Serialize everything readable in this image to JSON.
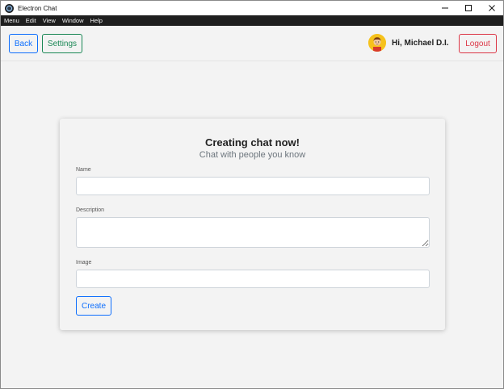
{
  "window": {
    "title": "Electron Chat",
    "icon": "electron-app-icon",
    "controls": [
      "minimize-icon",
      "maximize-icon",
      "close-icon"
    ]
  },
  "menubar": {
    "items": [
      "Menu",
      "Edit",
      "View",
      "Window",
      "Help"
    ]
  },
  "header": {
    "back_label": "Back",
    "settings_label": "Settings",
    "greeting": "Hi, Michael D.I.",
    "logout_label": "Logout",
    "avatar_icon": "cartoon-avatar-icon"
  },
  "form": {
    "title": "Creating chat now!",
    "subtitle": "Chat with people you know",
    "name_label": "Name",
    "name_value": "",
    "description_label": "Description",
    "description_value": "",
    "image_label": "Image",
    "image_value": "",
    "create_label": "Create"
  },
  "colors": {
    "primary": "#0d6efd",
    "success": "#198754",
    "danger": "#dc3545",
    "background": "#f3f3f3",
    "menubar": "#1e1e1e"
  }
}
